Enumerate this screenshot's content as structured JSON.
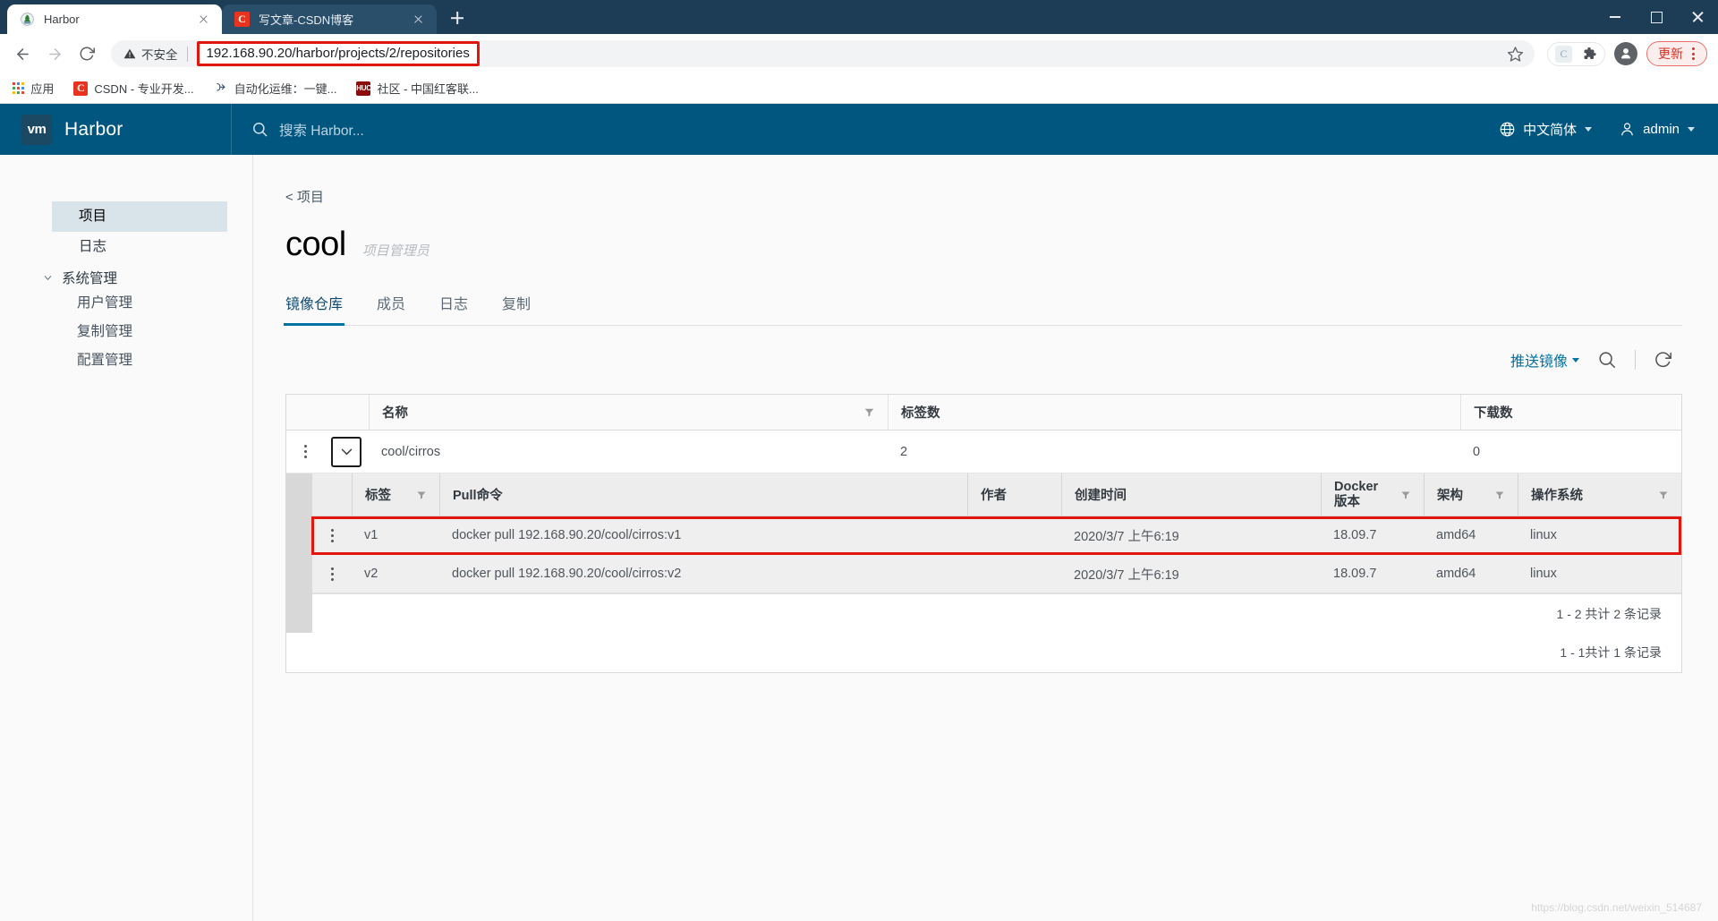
{
  "browser": {
    "tabs": [
      {
        "title": "Harbor",
        "favicon": "harbor-icon",
        "active": true
      },
      {
        "title": "写文章-CSDN博客",
        "favicon": "csdn-icon",
        "active": false
      }
    ],
    "newtab_label": "+",
    "window_controls": [
      "minimize",
      "maximize",
      "close"
    ],
    "toolbar": {
      "back": "back-arrow",
      "forward": "forward-arrow",
      "reload": "reload-icon",
      "security_label": "不安全",
      "url": "192.168.90.20/harbor/projects/2/repositories",
      "bookmark_star": "star-icon",
      "extension_c": "C",
      "extension_puzzle": "puzzle-icon",
      "profile": "profile-icon",
      "update_label": "更新",
      "menu": "kebab-menu-icon"
    },
    "bookmarks": [
      {
        "label": "应用",
        "icon": "apps-grid-icon"
      },
      {
        "label": "CSDN - 专业开发...",
        "icon": "csdn-icon"
      },
      {
        "label": "自动化运维：一键...",
        "icon": "script-icon"
      },
      {
        "label": "社区 - 中国红客联...",
        "icon": "huc-icon"
      }
    ]
  },
  "harbor": {
    "brand": {
      "logo": "vm",
      "name": "Harbor"
    },
    "search_placeholder": "搜索 Harbor...",
    "language": "中文简体",
    "user": "admin",
    "sidebar": {
      "items": [
        {
          "label": "项目",
          "active": true
        },
        {
          "label": "日志",
          "active": false
        }
      ],
      "group": {
        "label": "系统管理",
        "expanded": true,
        "children": [
          {
            "label": "用户管理"
          },
          {
            "label": "复制管理"
          },
          {
            "label": "配置管理"
          }
        ]
      }
    },
    "breadcrumb": "< 项目",
    "project": {
      "name": "cool",
      "role": "项目管理员"
    },
    "tabs": [
      {
        "label": "镜像仓库",
        "active": true
      },
      {
        "label": "成员",
        "active": false
      },
      {
        "label": "日志",
        "active": false
      },
      {
        "label": "复制",
        "active": false
      }
    ],
    "actions": {
      "push_image": "推送镜像",
      "search_icon": "search-icon",
      "refresh_icon": "refresh-icon"
    },
    "repo_table": {
      "columns": [
        "名称",
        "标签数",
        "下载数"
      ],
      "rows": [
        {
          "name": "cool/cirros",
          "tags": "2",
          "downloads": "0",
          "expanded": true
        }
      ],
      "pager": "1 - 1共计 1 条记录"
    },
    "tag_table": {
      "columns": [
        "标签",
        "Pull命令",
        "作者",
        "创建时间",
        "Docker 版本",
        "架构",
        "操作系统"
      ],
      "docker_col_line1": "Docker",
      "docker_col_line2": "版本",
      "rows": [
        {
          "tag": "v1",
          "pull": "docker pull 192.168.90.20/cool/cirros:v1",
          "author": "",
          "created": "2020/3/7 上午6:19",
          "docker": "18.09.7",
          "arch": "amd64",
          "os": "linux",
          "highlighted": true
        },
        {
          "tag": "v2",
          "pull": "docker pull 192.168.90.20/cool/cirros:v2",
          "author": "",
          "created": "2020/3/7 上午6:19",
          "docker": "18.09.7",
          "arch": "amd64",
          "os": "linux",
          "highlighted": false
        }
      ],
      "pager": "1 - 2 共计 2 条记录"
    },
    "watermark": "https://blog.csdn.net/weixin_514687"
  },
  "colors": {
    "browser_titlebar": "#1d3c56",
    "harbor_header": "#00567f",
    "accent_blue": "#0072a3",
    "highlight_red": "#e3160f",
    "update_red": "#d93025"
  }
}
